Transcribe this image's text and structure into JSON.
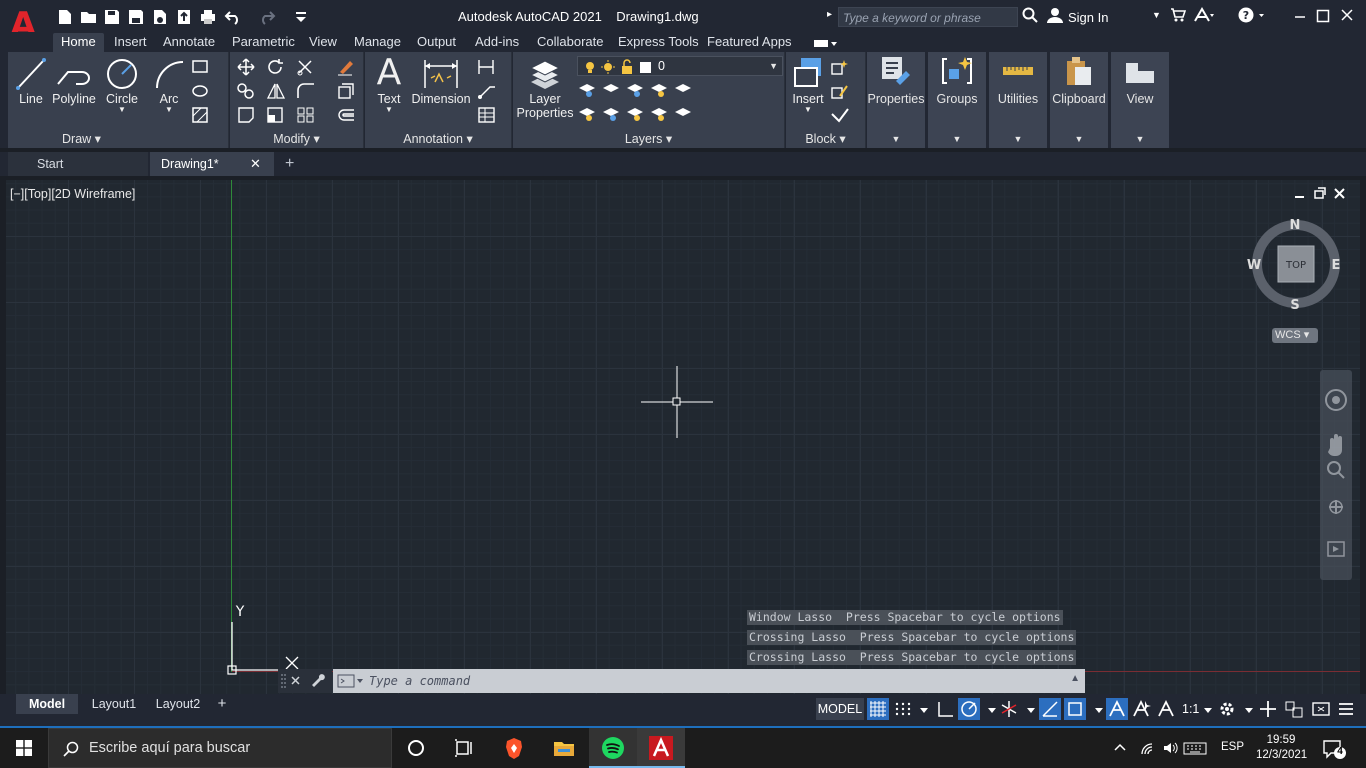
{
  "window": {
    "title": "Autodesk AutoCAD 2021    Drawing1.dwg",
    "search_placeholder": "Type a keyword or phrase",
    "sign_in": "Sign In",
    "logo_letter": "A"
  },
  "ribbon_tabs": [
    "Home",
    "Insert",
    "Annotate",
    "Parametric",
    "View",
    "Manage",
    "Output",
    "Add-ins",
    "Collaborate",
    "Express Tools",
    "Featured Apps"
  ],
  "ribbon": {
    "draw": {
      "title": "Draw",
      "line": "Line",
      "polyline": "Polyline",
      "circle": "Circle",
      "arc": "Arc"
    },
    "modify": {
      "title": "Modify"
    },
    "annotation": {
      "title": "Annotation",
      "text": "Text",
      "dimension": "Dimension",
      "text_glyph": "A"
    },
    "layers": {
      "title": "Layers",
      "layer_properties_1": "Layer",
      "layer_properties_2": "Properties",
      "current_layer": "0"
    },
    "block": {
      "title": "Block",
      "insert": "Insert"
    },
    "properties": "Properties",
    "groups": "Groups",
    "utilities": "Utilities",
    "clipboard": "Clipboard",
    "view": "View"
  },
  "file_tabs": {
    "start": "Start",
    "drawing": "Drawing1*",
    "close": "✕",
    "add": "+"
  },
  "viewport": {
    "label": "[−][Top][2D Wireframe]",
    "viewcube_top": "TOP",
    "compass_n": "N",
    "compass_s": "S",
    "compass_e": "E",
    "compass_w": "W",
    "wcs": "WCS",
    "ucs_y": "Y"
  },
  "lasso_messages": [
    "Window Lasso  Press Spacebar to cycle options",
    "Crossing Lasso  Press Spacebar to cycle options",
    "Crossing Lasso  Press Spacebar to cycle options"
  ],
  "command_line": {
    "placeholder": "Type a command"
  },
  "layout_tabs": [
    "Model",
    "Layout1",
    "Layout2"
  ],
  "layout_add": "+",
  "status_bar": {
    "model": "MODEL",
    "scale": "1:1"
  },
  "taskbar": {
    "search_placeholder": "Escribe aquí para buscar",
    "language": "ESP",
    "time": "19:59",
    "date": "12/3/2021",
    "notifications": "4"
  },
  "colors": {
    "accent_blue": "#2c6ebf",
    "autocad_red": "#e2242b",
    "ribbon_bg": "#39404e",
    "viewport_bg": "#212830"
  }
}
